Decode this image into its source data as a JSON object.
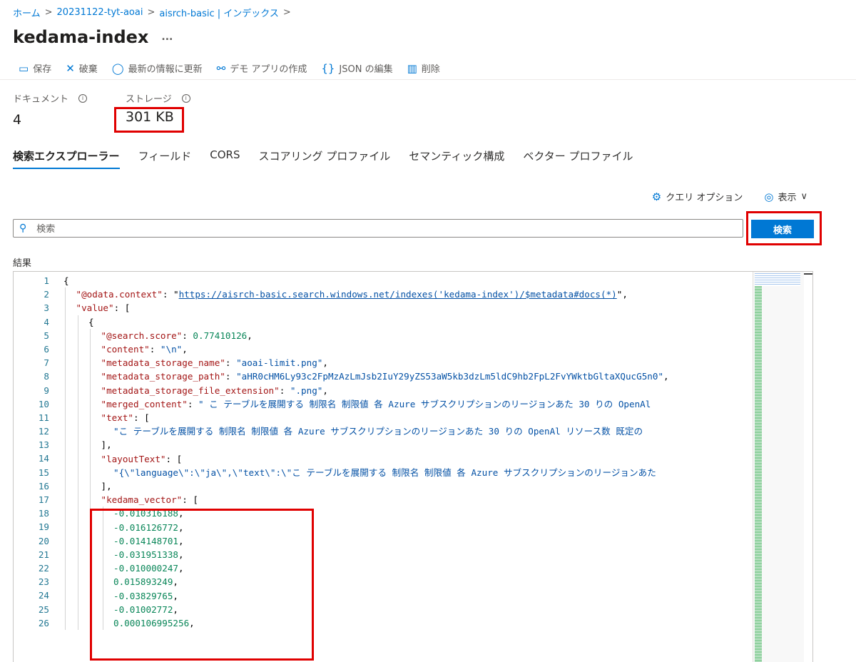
{
  "breadcrumb": {
    "items": [
      "ホーム",
      "20231122-tyt-aoai",
      "aisrch-basic | インデックス"
    ],
    "sep": ">"
  },
  "page": {
    "title": "kedama-index",
    "more": "..."
  },
  "toolbar": {
    "items": [
      {
        "icon": "save-icon",
        "glyph": "▭",
        "label": "保存"
      },
      {
        "icon": "discard-icon",
        "glyph": "✕",
        "label": "破棄"
      },
      {
        "icon": "refresh-icon",
        "glyph": "◯",
        "label": "最新の情報に更新"
      },
      {
        "icon": "demo-app-icon",
        "glyph": "⚯",
        "label": "デモ アプリの作成"
      },
      {
        "icon": "json-icon",
        "glyph": "{}",
        "label": "JSON の編集"
      },
      {
        "icon": "delete-icon",
        "glyph": "▥",
        "label": "削除"
      }
    ]
  },
  "stats": {
    "documents": {
      "label": "ドキュメント",
      "value": "4"
    },
    "storage": {
      "label": "ストレージ",
      "value": "301 KB"
    }
  },
  "tabs": [
    "検索エクスプローラー",
    "フィールド",
    "CORS",
    "スコアリング プロファイル",
    "セマンティック構成",
    "ベクター プロファイル"
  ],
  "options": {
    "query_options": {
      "icon": "gear-icon",
      "label": "クエリ オプション"
    },
    "view": {
      "icon": "eye-icon",
      "label": "表示",
      "chevron": "∨"
    }
  },
  "search": {
    "placeholder": "検索",
    "value": "",
    "button_label": "検索"
  },
  "results_label": "結果",
  "code_lines": [
    {
      "num": "1",
      "indent": 0,
      "tokens": [
        {
          "t": "p",
          "v": "{"
        }
      ]
    },
    {
      "num": "2",
      "indent": 1,
      "tokens": [
        {
          "t": "k",
          "v": "\"@odata.context\""
        },
        {
          "t": "p",
          "v": ": \""
        },
        {
          "t": "u",
          "v": "https://aisrch-basic.search.windows.net/indexes('kedama-index')/$metadata#docs(*)"
        },
        {
          "t": "p",
          "v": "\","
        }
      ]
    },
    {
      "num": "3",
      "indent": 1,
      "tokens": [
        {
          "t": "k",
          "v": "\"value\""
        },
        {
          "t": "p",
          "v": ": ["
        }
      ]
    },
    {
      "num": "4",
      "indent": 2,
      "tokens": [
        {
          "t": "p",
          "v": "{"
        }
      ]
    },
    {
      "num": "5",
      "indent": 3,
      "tokens": [
        {
          "t": "k",
          "v": "\"@search.score\""
        },
        {
          "t": "p",
          "v": ": "
        },
        {
          "t": "n",
          "v": "0.77410126"
        },
        {
          "t": "p",
          "v": ","
        }
      ]
    },
    {
      "num": "6",
      "indent": 3,
      "tokens": [
        {
          "t": "k",
          "v": "\"content\""
        },
        {
          "t": "p",
          "v": ": "
        },
        {
          "t": "s",
          "v": "\"\\n\""
        },
        {
          "t": "p",
          "v": ","
        }
      ]
    },
    {
      "num": "7",
      "indent": 3,
      "tokens": [
        {
          "t": "k",
          "v": "\"metadata_storage_name\""
        },
        {
          "t": "p",
          "v": ": "
        },
        {
          "t": "s",
          "v": "\"aoai-limit.png\""
        },
        {
          "t": "p",
          "v": ","
        }
      ]
    },
    {
      "num": "8",
      "indent": 3,
      "tokens": [
        {
          "t": "k",
          "v": "\"metadata_storage_path\""
        },
        {
          "t": "p",
          "v": ": "
        },
        {
          "t": "s",
          "v": "\"aHR0cHM6Ly93c2FpMzAzLmJsb2IuY29yZS53aW5kb3dzLm5ldC9hb2FpL2FvYWktbGltaXQucG5n0\""
        },
        {
          "t": "p",
          "v": ","
        }
      ]
    },
    {
      "num": "9",
      "indent": 3,
      "tokens": [
        {
          "t": "k",
          "v": "\"metadata_storage_file_extension\""
        },
        {
          "t": "p",
          "v": ": "
        },
        {
          "t": "s",
          "v": "\".png\""
        },
        {
          "t": "p",
          "v": ","
        }
      ]
    },
    {
      "num": "10",
      "indent": 3,
      "tokens": [
        {
          "t": "k",
          "v": "\"merged_content\""
        },
        {
          "t": "p",
          "v": ": "
        },
        {
          "t": "s",
          "v": "\" こ テーブルを展開する 制限名 制限値 各 Azure サブスクリプションのリージョンあた 30 りの OpenAl"
        }
      ]
    },
    {
      "num": "11",
      "indent": 3,
      "tokens": [
        {
          "t": "k",
          "v": "\"text\""
        },
        {
          "t": "p",
          "v": ": ["
        }
      ]
    },
    {
      "num": "12",
      "indent": 4,
      "tokens": [
        {
          "t": "s",
          "v": "\"こ テーブルを展開する 制限名 制限値 各 Azure サブスクリプションのリージョンあた 30 りの OpenAl リソース数 既定の"
        }
      ]
    },
    {
      "num": "13",
      "indent": 3,
      "tokens": [
        {
          "t": "p",
          "v": "],"
        }
      ]
    },
    {
      "num": "14",
      "indent": 3,
      "tokens": [
        {
          "t": "k",
          "v": "\"layoutText\""
        },
        {
          "t": "p",
          "v": ": ["
        }
      ]
    },
    {
      "num": "15",
      "indent": 4,
      "tokens": [
        {
          "t": "s",
          "v": "\"{\\\"language\\\":\\\"ja\\\",\\\"text\\\":\\\"こ テーブルを展開する 制限名 制限値 各 Azure サブスクリプションのリージョンあた"
        }
      ]
    },
    {
      "num": "16",
      "indent": 3,
      "tokens": [
        {
          "t": "p",
          "v": "],"
        }
      ]
    },
    {
      "num": "17",
      "indent": 3,
      "tokens": [
        {
          "t": "k",
          "v": "\"kedama_vector\""
        },
        {
          "t": "p",
          "v": ": ["
        }
      ]
    },
    {
      "num": "18",
      "indent": 4,
      "tokens": [
        {
          "t": "n",
          "v": "-0.010316188"
        },
        {
          "t": "p",
          "v": ","
        }
      ]
    },
    {
      "num": "19",
      "indent": 4,
      "tokens": [
        {
          "t": "n",
          "v": "-0.016126772"
        },
        {
          "t": "p",
          "v": ","
        }
      ]
    },
    {
      "num": "20",
      "indent": 4,
      "tokens": [
        {
          "t": "n",
          "v": "-0.014148701"
        },
        {
          "t": "p",
          "v": ","
        }
      ]
    },
    {
      "num": "21",
      "indent": 4,
      "tokens": [
        {
          "t": "n",
          "v": "-0.031951338"
        },
        {
          "t": "p",
          "v": ","
        }
      ]
    },
    {
      "num": "22",
      "indent": 4,
      "tokens": [
        {
          "t": "n",
          "v": "-0.010000247"
        },
        {
          "t": "p",
          "v": ","
        }
      ]
    },
    {
      "num": "23",
      "indent": 4,
      "tokens": [
        {
          "t": "n",
          "v": "0.015893249"
        },
        {
          "t": "p",
          "v": ","
        }
      ]
    },
    {
      "num": "24",
      "indent": 4,
      "tokens": [
        {
          "t": "n",
          "v": "-0.03829765"
        },
        {
          "t": "p",
          "v": ","
        }
      ]
    },
    {
      "num": "25",
      "indent": 4,
      "tokens": [
        {
          "t": "n",
          "v": "-0.01002772"
        },
        {
          "t": "p",
          "v": ","
        }
      ]
    },
    {
      "num": "26",
      "indent": 4,
      "tokens": [
        {
          "t": "n",
          "v": "0.000106995256"
        },
        {
          "t": "p",
          "v": ","
        }
      ]
    }
  ],
  "colors": {
    "accent": "#0078d4",
    "highlight_box": "#e00000"
  }
}
